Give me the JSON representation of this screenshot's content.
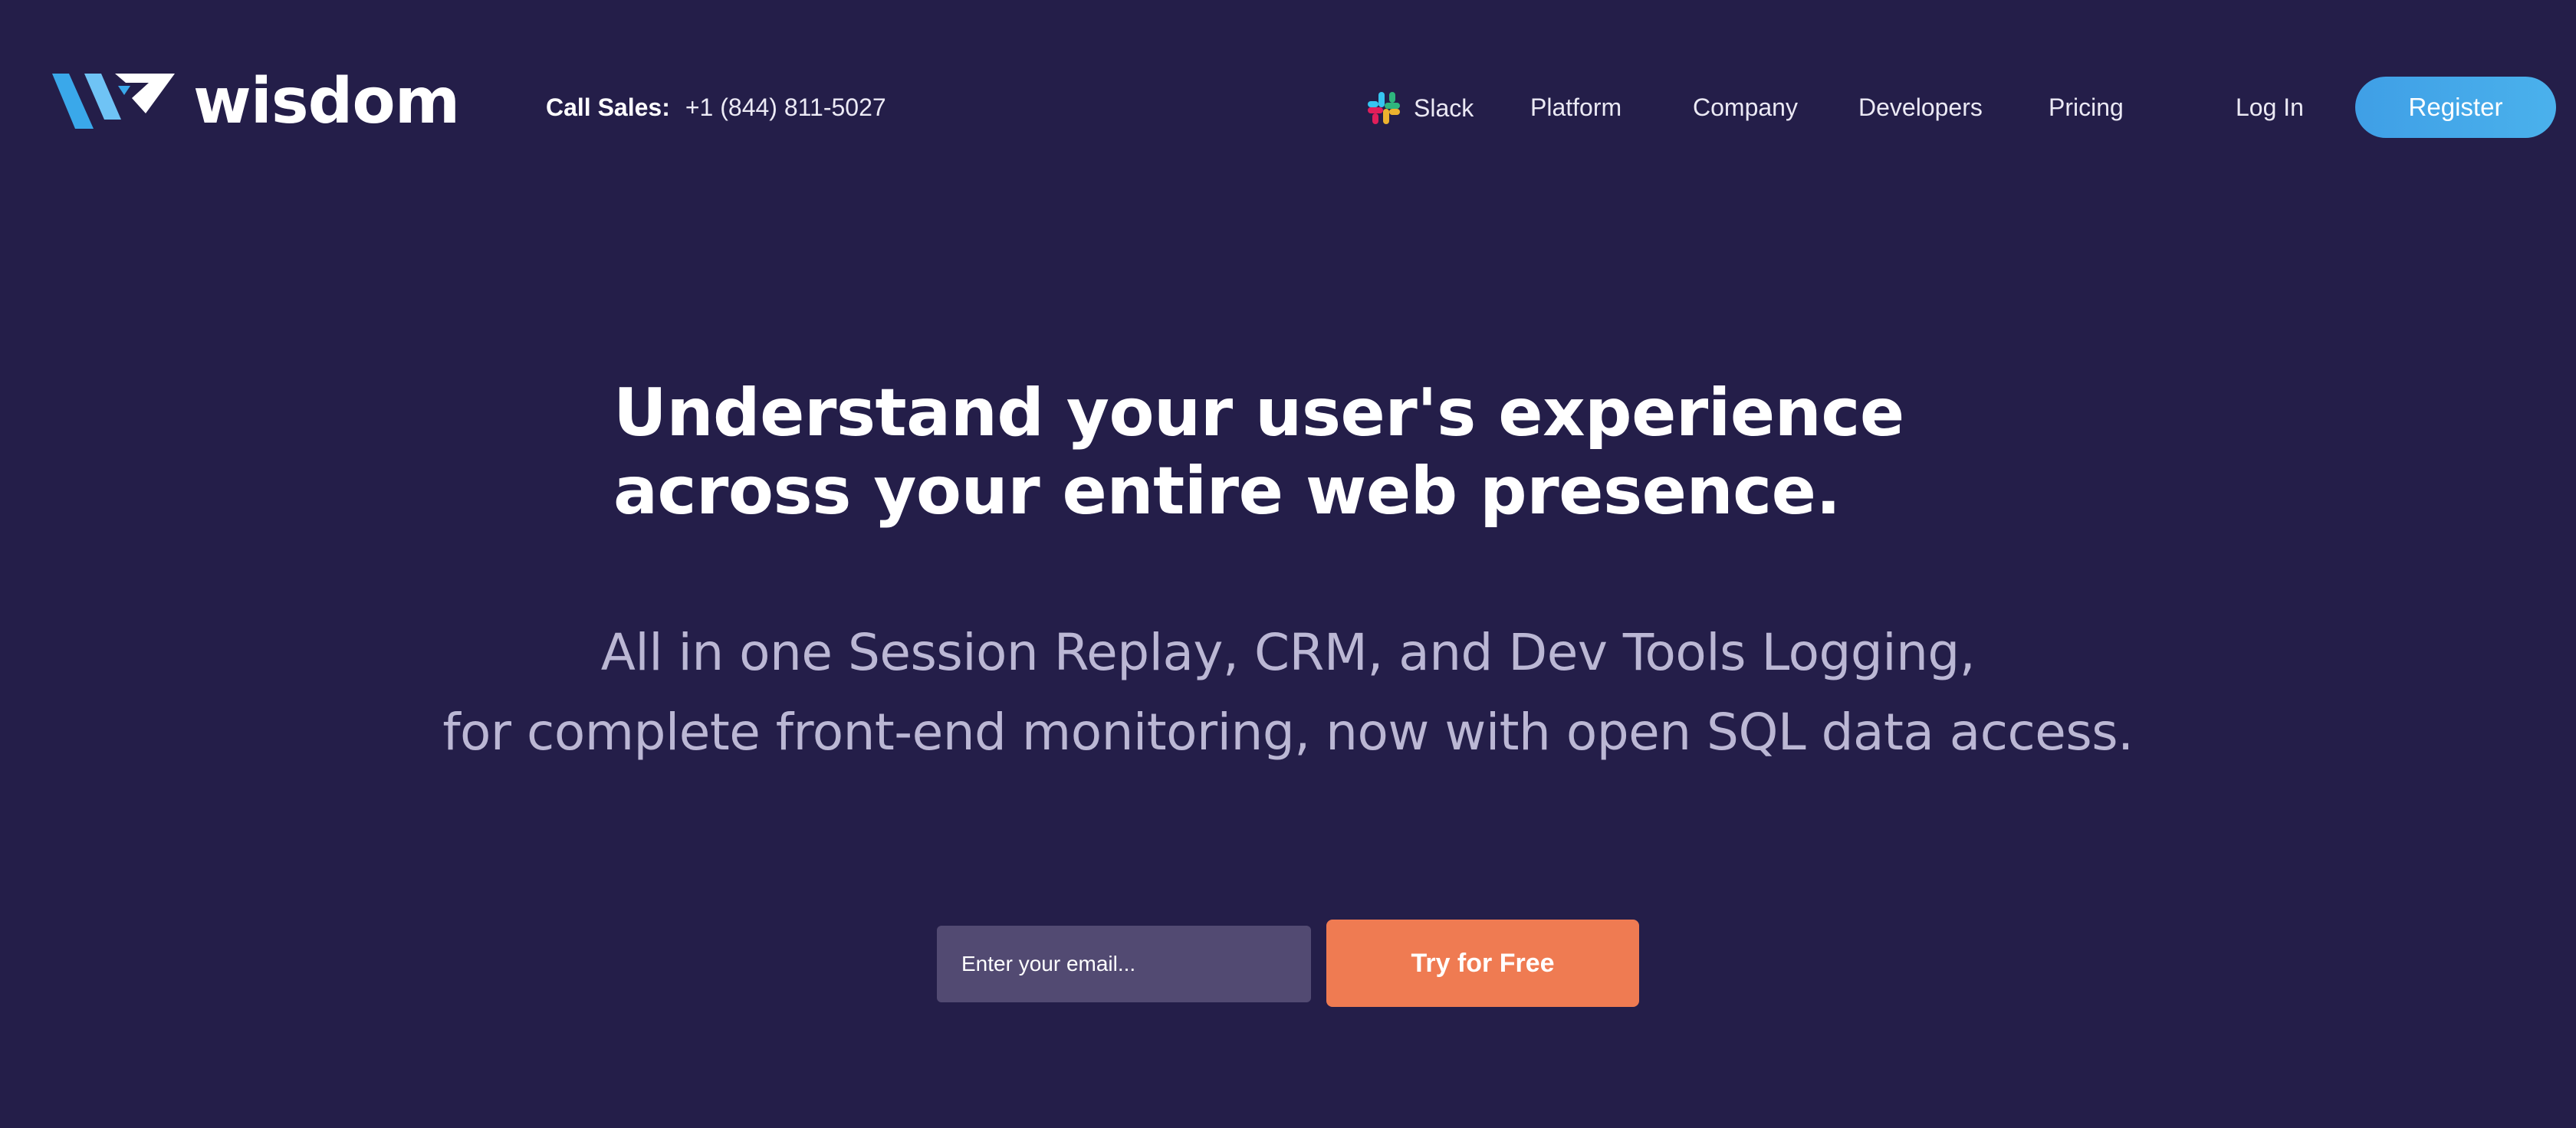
{
  "brand": {
    "name": "wisdom",
    "logo_icon": "wisdom-w-mark-icon",
    "colors": {
      "background": "#241e49",
      "accent_blue": "#3f9fe6",
      "cta_orange": "#ef7b52",
      "input_bg": "#524a72"
    }
  },
  "header": {
    "call_sales_label": "Call Sales:",
    "call_sales_phone": "+1 (844) 811-5027",
    "nav": {
      "slack": {
        "label": "Slack",
        "icon": "slack-icon"
      },
      "platform": "Platform",
      "company": "Company",
      "developers": "Developers",
      "pricing": "Pricing",
      "login": "Log In",
      "register": "Register"
    }
  },
  "hero": {
    "title_line1": "Understand your user's experience",
    "title_line2": "across your entire web presence.",
    "subtitle_line1": "All in one Session Replay, CRM, and Dev Tools Logging,",
    "subtitle_line2": "for complete front-end monitoring, now with open SQL data access."
  },
  "signup": {
    "email_placeholder": "Enter your email...",
    "email_value": "",
    "cta_label": "Try for Free"
  }
}
